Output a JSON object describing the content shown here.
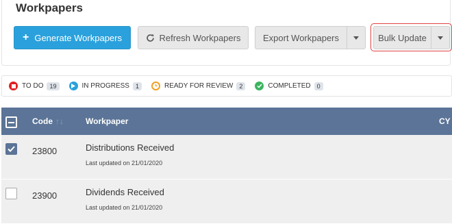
{
  "page": {
    "title": "Workpapers"
  },
  "toolbar": {
    "generate_label": "Generate Workpapers",
    "refresh_label": "Refresh Workpapers",
    "export_label": "Export Workpapers",
    "bulk_label": "Bulk Update"
  },
  "statuses": [
    {
      "label": "TO DO",
      "count": "19",
      "color": "#e02020",
      "icon": "stop-icon"
    },
    {
      "label": "IN PROGRESS",
      "count": "1",
      "color": "#2aa1dc",
      "icon": "play-icon"
    },
    {
      "label": "READY FOR REVIEW",
      "count": "2",
      "color": "#f0a020",
      "icon": "clock-icon"
    },
    {
      "label": "COMPLETED",
      "count": "0",
      "color": "#3cb460",
      "icon": "check-circle-icon"
    }
  ],
  "table": {
    "columns": {
      "code": "Code",
      "workpaper": "Workpaper",
      "cy": "CY"
    },
    "rows": [
      {
        "code": "23800",
        "name": "Distributions Received",
        "updated": "Last updated on 21/01/2020",
        "checked": true
      },
      {
        "code": "23900",
        "name": "Dividends Received",
        "updated": "Last updated on 21/01/2020",
        "checked": false
      }
    ]
  },
  "colors": {
    "primary": "#2aa1dc",
    "header": "#5b7497",
    "highlight": "#e04040"
  }
}
